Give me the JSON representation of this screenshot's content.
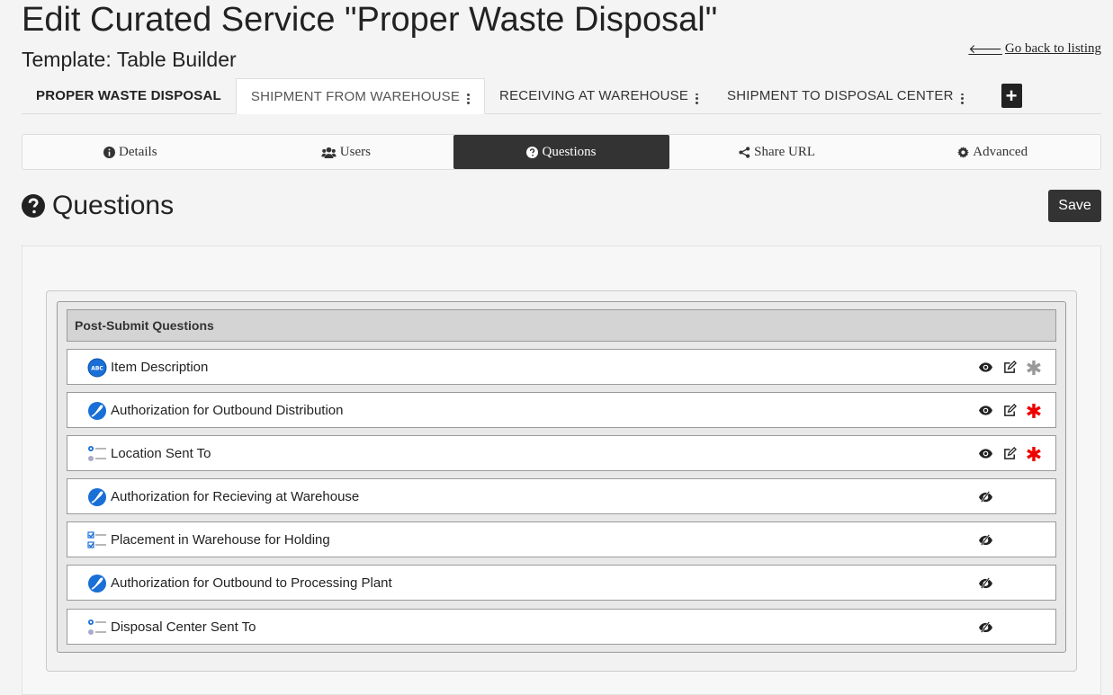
{
  "header": {
    "title": "Edit Curated Service \"Proper Waste Disposal\"",
    "subtitle": "Template: Table Builder",
    "back_link": "Go back to listing"
  },
  "top_tabs": [
    {
      "label": "PROPER WASTE DISPOSAL"
    },
    {
      "label": "SHIPMENT FROM WAREHOUSE"
    },
    {
      "label": "RECEIVING AT WAREHOUSE"
    },
    {
      "label": "SHIPMENT TO DISPOSAL CENTER"
    }
  ],
  "active_top_tab": "SHIPMENT FROM WAREHOUSE",
  "subnav": [
    {
      "label": "Details",
      "icon": "info-circle-icon"
    },
    {
      "label": "Users",
      "icon": "users-icon"
    },
    {
      "label": "Questions",
      "icon": "question-circle-icon"
    },
    {
      "label": "Share URL",
      "icon": "share-icon"
    },
    {
      "label": "Advanced",
      "icon": "gear-icon"
    }
  ],
  "active_subnav": "Questions",
  "section": {
    "title": "Questions",
    "save_label": "Save"
  },
  "questions_group": {
    "header": "Post-Submit Questions",
    "rows": [
      {
        "label": "Item Description",
        "type_icon": "text-bubble-icon",
        "visible": true,
        "required": false
      },
      {
        "label": "Authorization for Outbound Distribution",
        "type_icon": "signature-bubble-icon",
        "visible": true,
        "required": true
      },
      {
        "label": "Location Sent To",
        "type_icon": "radio-list-icon",
        "visible": true,
        "required": true
      },
      {
        "label": "Authorization for Recieving at Warehouse",
        "type_icon": "signature-bubble-icon",
        "visible": false,
        "required": false
      },
      {
        "label": "Placement in Warehouse for Holding",
        "type_icon": "checkbox-list-icon",
        "visible": false,
        "required": false
      },
      {
        "label": "Authorization for Outbound to Processing Plant",
        "type_icon": "signature-bubble-icon",
        "visible": false,
        "required": false
      },
      {
        "label": "Disposal Center Sent To",
        "type_icon": "radio-list-icon",
        "visible": false,
        "required": false
      }
    ]
  },
  "colors": {
    "dark": "#333333",
    "required_star": "#ee0000",
    "optional_star": "#999999",
    "icon_blue": "#1a6fd6"
  }
}
